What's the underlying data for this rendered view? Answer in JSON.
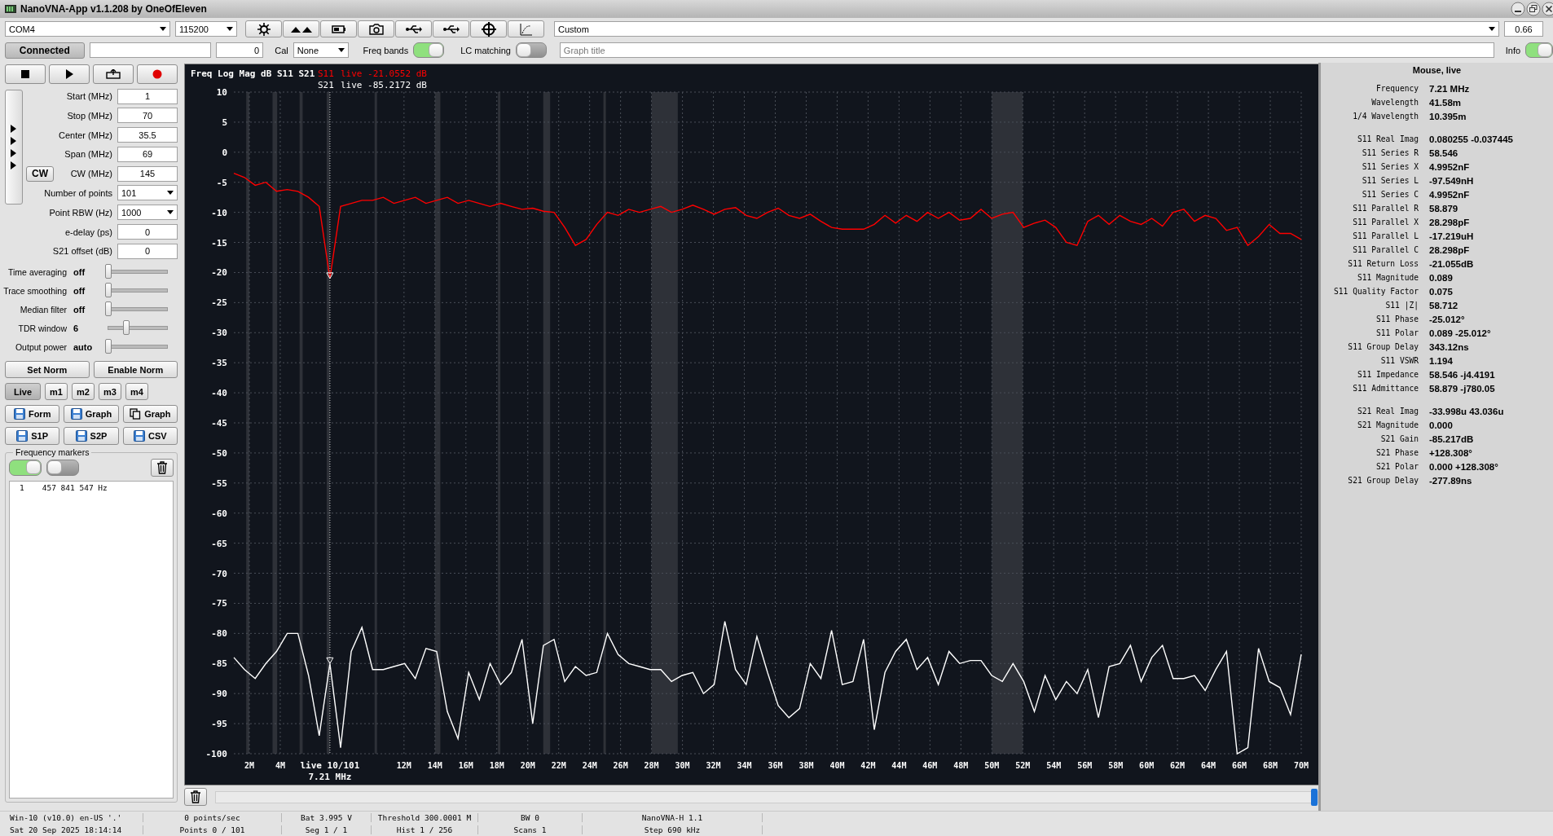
{
  "window": {
    "title": "NanoVNA-App v1.1.208 by OneOfEleven"
  },
  "toolbar": {
    "port": "COM4",
    "baud": "115200",
    "preset": "Custom",
    "zoom": "0.66"
  },
  "toolbar2": {
    "connect_button": "Connected",
    "counter": "0",
    "cal_label": "Cal",
    "cal": "None",
    "freq_bands": {
      "label": "Freq bands",
      "on": true
    },
    "lc_matching": {
      "label": "LC matching",
      "on": false
    },
    "graph_title": {
      "placeholder": "Graph title"
    },
    "info": {
      "label": "Info",
      "on": true
    }
  },
  "sweep_fields": [
    {
      "label": "Start (MHz)",
      "value": "1",
      "kind": "input"
    },
    {
      "label": "Stop (MHz)",
      "value": "70",
      "kind": "input"
    },
    {
      "label": "Center (MHz)",
      "value": "35.5",
      "kind": "input"
    },
    {
      "label": "Span (MHz)",
      "value": "69",
      "kind": "input"
    },
    {
      "label": "CW (MHz)",
      "value": "145",
      "kind": "input",
      "button": "CW"
    },
    {
      "label": "Number of points",
      "value": "101",
      "kind": "select"
    },
    {
      "label": "Point RBW (Hz)",
      "value": "1000",
      "kind": "select"
    },
    {
      "label": "e-delay (ps)",
      "value": "0",
      "kind": "input"
    },
    {
      "label": "S21 offset (dB)",
      "value": "0",
      "kind": "input"
    }
  ],
  "sliders": [
    {
      "label": "Time averaging",
      "value": "off",
      "level": 0
    },
    {
      "label": "Trace smoothing",
      "value": "off",
      "level": 0
    },
    {
      "label": "Median filter",
      "value": "off",
      "level": 0
    },
    {
      "label": "TDR window",
      "value": "6",
      "level": 0.3
    },
    {
      "label": "Output power",
      "value": "auto",
      "level": 0
    }
  ],
  "norm_buttons": [
    "Set Norm",
    "Enable Norm"
  ],
  "trace_tabs": [
    {
      "label": "Live",
      "selected": true
    },
    {
      "label": "m1",
      "selected": false
    },
    {
      "label": "m2",
      "selected": false
    },
    {
      "label": "m3",
      "selected": false
    },
    {
      "label": "m4",
      "selected": false
    }
  ],
  "save_buttons": [
    {
      "label": "Form",
      "kind": "save"
    },
    {
      "label": "Graph",
      "kind": "save"
    },
    {
      "label": "Graph",
      "kind": "copy"
    },
    {
      "label": "S1P",
      "kind": "save"
    },
    {
      "label": "S2P",
      "kind": "save"
    },
    {
      "label": "CSV",
      "kind": "save"
    }
  ],
  "frequency_markers": {
    "title": "Frequency markers",
    "toggles": [
      {
        "on": true
      },
      {
        "on": false
      }
    ],
    "items": [
      {
        "number": "1",
        "frequency": "457 841 547 Hz"
      }
    ]
  },
  "chart": {
    "readings": [
      {
        "text": "live -21.0552 dB"
      },
      {
        "text": "live -85.2172 dB"
      }
    ],
    "cursor_frequency": "7.21 MHz",
    "chart_data": {
      "type": "line",
      "title": "Freq Log Mag dB S11 S21",
      "grid": true,
      "xlim": [
        1,
        70
      ],
      "ylim": [
        -100,
        10
      ],
      "x": [
        1,
        1.69,
        2.38,
        3.07,
        3.76,
        4.45,
        5.14,
        5.83,
        6.52,
        7.21,
        7.9,
        8.59,
        9.28,
        9.97,
        10.66,
        11.35,
        12.04,
        12.73,
        13.42,
        14.11,
        14.8,
        15.49,
        16.18,
        16.87,
        17.56,
        18.25,
        18.94,
        19.63,
        20.32,
        21.01,
        21.7,
        22.39,
        23.08,
        23.77,
        24.46,
        25.15,
        25.84,
        26.53,
        27.22,
        27.91,
        28.6,
        29.29,
        29.98,
        30.67,
        31.36,
        32.05,
        32.74,
        33.43,
        34.12,
        34.81,
        35.5,
        36.19,
        36.88,
        37.57,
        38.26,
        38.95,
        39.64,
        40.33,
        41.02,
        41.71,
        42.4,
        43.09,
        43.78,
        44.47,
        45.16,
        45.85,
        46.54,
        47.23,
        47.92,
        48.61,
        49.3,
        49.99,
        50.68,
        51.37,
        52.06,
        52.75,
        53.44,
        54.13,
        54.82,
        55.51,
        56.2,
        56.89,
        57.58,
        58.27,
        58.96,
        59.65,
        60.34,
        61.03,
        61.72,
        62.41,
        63.1,
        63.79,
        64.48,
        65.17,
        65.86,
        66.55,
        67.24,
        67.93,
        68.62,
        69.31,
        70
      ],
      "series": [
        {
          "name": "S11",
          "color": "#ff0000",
          "values": [
            -3.5,
            -4.2,
            -5.5,
            -5,
            -6.5,
            -6.2,
            -6.5,
            -7.5,
            -9,
            -21,
            -9,
            -8.5,
            -8,
            -8,
            -7.5,
            -8.5,
            -8,
            -7.5,
            -8.5,
            -8,
            -7.5,
            -8.5,
            -8,
            -8.5,
            -9,
            -8.5,
            -9,
            -9.5,
            -9.3,
            -9.8,
            -10,
            -12.5,
            -15.5,
            -14.5,
            -12,
            -10,
            -10.5,
            -9.5,
            -10,
            -9.5,
            -9,
            -10,
            -9.5,
            -8.8,
            -9.5,
            -10.3,
            -9.5,
            -9.2,
            -10.5,
            -11,
            -10,
            -9.3,
            -10.5,
            -11,
            -10.3,
            -11.5,
            -12.5,
            -12.8,
            -12.8,
            -12.8,
            -12,
            -10.5,
            -11.8,
            -10.5,
            -11.5,
            -10,
            -11,
            -10,
            -11.3,
            -11,
            -9.5,
            -11,
            -10.3,
            -10,
            -12.5,
            -11.8,
            -11.3,
            -12.5,
            -15,
            -15.5,
            -11.5,
            -10.5,
            -12,
            -10.5,
            -11.5,
            -12,
            -11,
            -12.3,
            -10,
            -9.5,
            -11.5,
            -10.5,
            -11,
            -13,
            -12.5,
            -15.5,
            -14,
            -12,
            -13.5,
            -13.5,
            -14.5
          ]
        },
        {
          "name": "S21",
          "color": "#ffffff",
          "values": [
            -84,
            -86,
            -87.5,
            -85,
            -83,
            -80,
            -80,
            -87,
            -97,
            -85,
            -99,
            -83,
            -79,
            -86,
            -86,
            -85.5,
            -85,
            -87.5,
            -82.5,
            -83,
            -93,
            -97.5,
            -86.5,
            -91,
            -85,
            -88.5,
            -86.5,
            -81,
            -95,
            -82,
            -81,
            -88,
            -85.5,
            -87,
            -86.5,
            -80,
            -83.5,
            -85,
            -85.5,
            -86,
            -86,
            -88,
            -87,
            -86.5,
            -90,
            -88.5,
            -78,
            -86,
            -88.5,
            -80.5,
            -86.5,
            -92,
            -94,
            -92.5,
            -85,
            -87.5,
            -79.5,
            -88.5,
            -88,
            -81,
            -96,
            -86.5,
            -83,
            -81,
            -86,
            -84,
            -88.5,
            -83,
            -85,
            -84.5,
            -84.5,
            -87,
            -88,
            -85,
            -88,
            -93,
            -87,
            -91,
            -88,
            -90,
            -86,
            -94,
            -85.5,
            -85,
            -82,
            -88,
            -84,
            -82,
            -87.5,
            -87.5,
            -87,
            -89.5,
            -86,
            -83,
            -100,
            -99,
            -82.5,
            -88,
            -89,
            -93.5,
            -83.5
          ]
        }
      ],
      "yticks": [
        10,
        5,
        0,
        -5,
        -10,
        -15,
        -20,
        -25,
        -30,
        -35,
        -40,
        -45,
        -50,
        -55,
        -60,
        -65,
        -70,
        -75,
        -80,
        -85,
        -90,
        -95,
        -100
      ],
      "xticks": [
        {
          "value": 2,
          "label": "2M"
        },
        {
          "value": 4,
          "label": "4M"
        },
        {
          "value": 12,
          "label": "12M"
        },
        {
          "value": 14,
          "label": "14M"
        },
        {
          "value": 16,
          "label": "16M"
        },
        {
          "value": 18,
          "label": "18M"
        },
        {
          "value": 20,
          "label": "20M"
        },
        {
          "value": 22,
          "label": "22M"
        },
        {
          "value": 24,
          "label": "24M"
        },
        {
          "value": 26,
          "label": "26M"
        },
        {
          "value": 28,
          "label": "28M"
        },
        {
          "value": 30,
          "label": "30M"
        },
        {
          "value": 32,
          "label": "32M"
        },
        {
          "value": 34,
          "label": "34M"
        },
        {
          "value": 36,
          "label": "36M"
        },
        {
          "value": 38,
          "label": "38M"
        },
        {
          "value": 40,
          "label": "40M"
        },
        {
          "value": 42,
          "label": "42M"
        },
        {
          "value": 44,
          "label": "44M"
        },
        {
          "value": 46,
          "label": "46M"
        },
        {
          "value": 48,
          "label": "48M"
        },
        {
          "value": 50,
          "label": "50M"
        },
        {
          "value": 52,
          "label": "52M"
        },
        {
          "value": 54,
          "label": "54M"
        },
        {
          "value": 56,
          "label": "56M"
        },
        {
          "value": 58,
          "label": "58M"
        },
        {
          "value": 60,
          "label": "60M"
        },
        {
          "value": 62,
          "label": "62M"
        },
        {
          "value": 64,
          "label": "64M"
        },
        {
          "value": 66,
          "label": "66M"
        },
        {
          "value": 68,
          "label": "68M"
        },
        {
          "value": 70,
          "label": "70M"
        }
      ],
      "ref_lines": [
        {
          "axis": "x",
          "value": 7.21
        }
      ],
      "annotations": [
        "live 10/101"
      ]
    }
  },
  "history_slider": {
    "level": 1
  },
  "info_panel": {
    "title": "Mouse, live",
    "groups": [
      {
        "rows": [
          {
            "label": "Frequency",
            "value": "7.21 MHz"
          },
          {
            "label": "Wavelength",
            "value": "41.58m"
          },
          {
            "label": "1/4 Wavelength",
            "value": "10.395m"
          }
        ]
      },
      {
        "rows": [
          {
            "label": "S11 Real Imag",
            "value": "0.080255 -0.037445"
          },
          {
            "label": "S11 Series R",
            "value": "58.546"
          },
          {
            "label": "S11 Series X",
            "value": "4.9952nF"
          },
          {
            "label": "S11 Series L",
            "value": "-97.549nH"
          },
          {
            "label": "S11 Series C",
            "value": "4.9952nF"
          },
          {
            "label": "S11 Parallel R",
            "value": "58.879"
          },
          {
            "label": "S11 Parallel X",
            "value": "28.298pF"
          },
          {
            "label": "S11 Parallel L",
            "value": "-17.219uH"
          },
          {
            "label": "S11 Parallel C",
            "value": "28.298pF"
          },
          {
            "label": "S11 Return Loss",
            "value": "-21.055dB"
          },
          {
            "label": "S11 Magnitude",
            "value": "0.089"
          },
          {
            "label": "S11 Quality Factor",
            "value": "0.075"
          },
          {
            "label": "S11 |Z|",
            "value": "58.712"
          },
          {
            "label": "S11 Phase",
            "value": "-25.012°"
          },
          {
            "label": "S11 Polar",
            "value": "0.089 -25.012°"
          },
          {
            "label": "S11 Group Delay",
            "value": "343.12ns"
          },
          {
            "label": "S11 VSWR",
            "value": "1.194"
          },
          {
            "label": "S11 Impedance",
            "value": "58.546 -j4.4191"
          },
          {
            "label": "S11 Admittance",
            "value": "58.879 -j780.05"
          }
        ]
      },
      {
        "rows": [
          {
            "label": "S21 Real Imag",
            "value": "-33.998u 43.036u"
          },
          {
            "label": "S21 Magnitude",
            "value": "0.000"
          },
          {
            "label": "S21 Gain",
            "value": "-85.217dB"
          },
          {
            "label": "S21 Phase",
            "value": "+128.308°"
          },
          {
            "label": "S21 Polar",
            "value": "0.000 +128.308°"
          },
          {
            "label": "S21 Group Delay",
            "value": "-277.89ns"
          }
        ]
      }
    ]
  },
  "status_bar": [
    {
      "cells": [
        "Win-10 (v10.0) en-US '.'",
        "0 points/sec",
        "Bat 3.995 V",
        "Threshold 300.0001 M",
        "BW 0",
        "NanoVNA-H 1.1"
      ]
    },
    {
      "cells": [
        "Sat 20 Sep 2025 18:14:14",
        "Points 0 / 101",
        "Seg 1 / 1",
        "Hist 1 / 256",
        "Scans 1",
        "Step 690 kHz"
      ]
    }
  ]
}
